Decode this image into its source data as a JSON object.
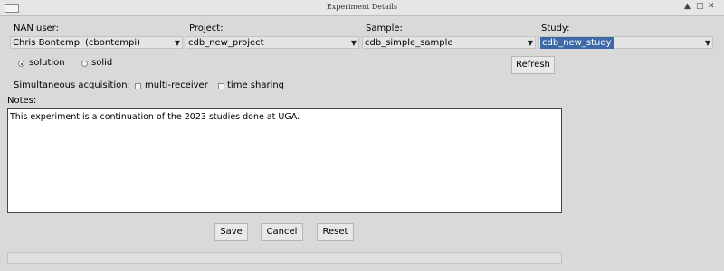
{
  "window": {
    "title": "Experiment Details",
    "controls": [
      "▲",
      "□",
      "✕"
    ]
  },
  "fields": {
    "nan_user": {
      "label": "NAN user:",
      "value": "Chris Bontempi (cbontempi)"
    },
    "project": {
      "label": "Project:",
      "value": "cdb_new_project"
    },
    "sample": {
      "label": "Sample:",
      "value": "cdb_simple_sample"
    },
    "study": {
      "label": "Study:",
      "value": "cdb_new_study"
    }
  },
  "sample_type": {
    "options": [
      "solution",
      "solid"
    ],
    "selected": "solution"
  },
  "refresh_label": "Refresh",
  "acquisition": {
    "label": "Simultaneous acquisition:",
    "options": [
      {
        "label": "multi-receiver",
        "checked": false
      },
      {
        "label": "time sharing",
        "checked": false
      }
    ]
  },
  "notes": {
    "label": "Notes:",
    "text": "This experiment is a continuation of the 2023 studies done at UGA."
  },
  "buttons": {
    "save": "Save",
    "cancel": "Cancel",
    "reset": "Reset"
  },
  "colors": {
    "selection": "#3d6aa6",
    "background": "#d9d9d9"
  }
}
